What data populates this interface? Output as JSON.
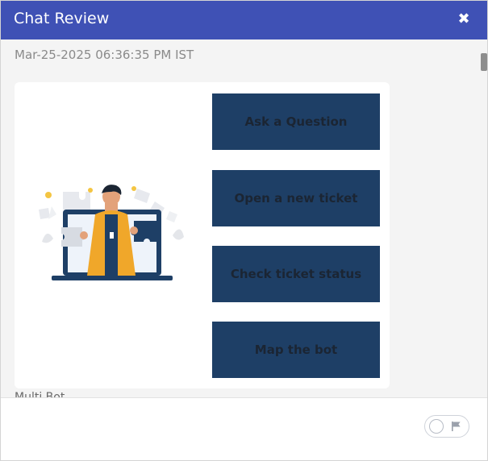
{
  "header": {
    "title": "Chat Review",
    "close_icon": "close-icon"
  },
  "content": {
    "timestamp": "Mar-25-2025 06:36:35 PM IST",
    "options": [
      "Ask a Question",
      "Open a new ticket",
      "Check ticket status",
      "Map the bot"
    ],
    "bot_label": "Multi Bot"
  },
  "colors": {
    "header_bg": "#3f51b5",
    "button_bg": "#1e3f66",
    "content_bg": "#f4f4f4"
  },
  "footer": {
    "toggle_icon": "flag-icon"
  }
}
